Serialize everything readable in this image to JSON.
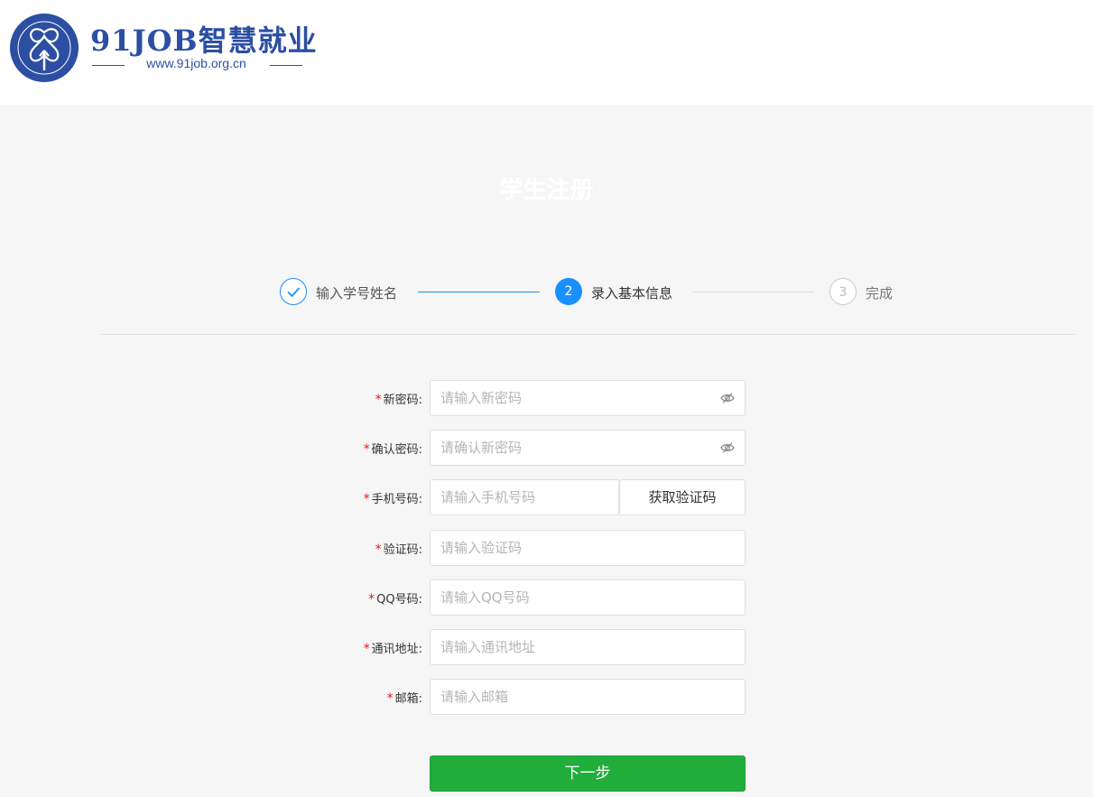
{
  "header": {
    "brand_title": "91JOB智慧就业",
    "brand_url": "www.91job.org.cn",
    "logo_ring_text": "91Job智慧就业"
  },
  "page": {
    "title": "学生注册"
  },
  "steps": [
    {
      "label": "输入学号姓名",
      "state": "done"
    },
    {
      "number": "2",
      "label": "录入基本信息",
      "state": "active"
    },
    {
      "number": "3",
      "label": "完成",
      "state": "pending"
    }
  ],
  "form": {
    "required_mark": "*",
    "fields": {
      "new_password": {
        "label": "新密码:",
        "placeholder": "请输入新密码",
        "icon": "eye-hidden-icon"
      },
      "confirm_password": {
        "label": "确认密码:",
        "placeholder": "请确认新密码",
        "icon": "eye-hidden-icon"
      },
      "phone": {
        "label": "手机号码:",
        "placeholder": "请输入手机号码"
      },
      "code": {
        "label": "验证码:",
        "placeholder": "请输入验证码"
      },
      "qq": {
        "label": "QQ号码:",
        "placeholder": "请输入QQ号码"
      },
      "address": {
        "label": "通讯地址:",
        "placeholder": "请输入通讯地址"
      },
      "email": {
        "label": "邮箱:",
        "placeholder": "请输入邮箱"
      }
    },
    "get_code_label": "获取验证码",
    "next_label": "下一步"
  },
  "colors": {
    "brand": "#2c4fa3",
    "accent": "#1890ff",
    "success": "#21ae3b",
    "required": "#e01b1b"
  }
}
